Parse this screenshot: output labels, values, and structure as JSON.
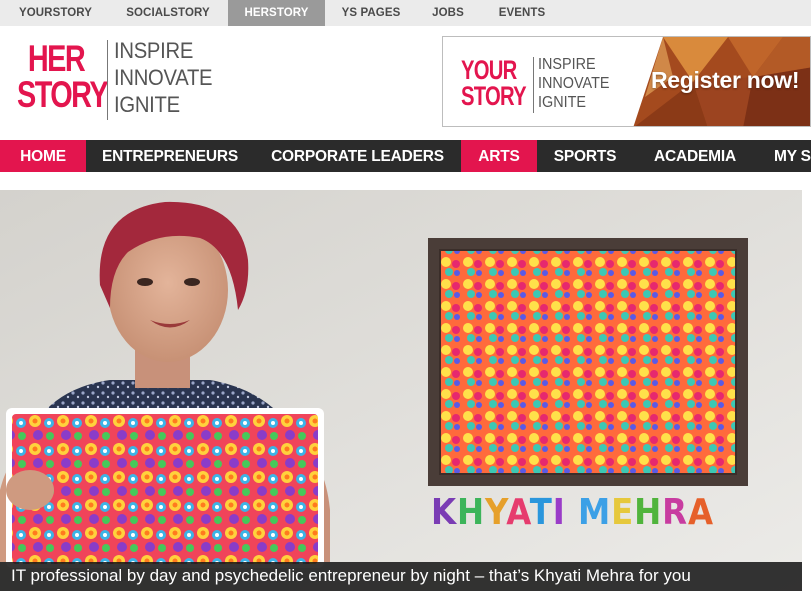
{
  "network_bar": {
    "items": [
      {
        "label": "YOURSTORY",
        "active": false
      },
      {
        "label": "SOCIALSTORY",
        "active": false
      },
      {
        "label": "HERSTORY",
        "active": true
      },
      {
        "label": "YS PAGES",
        "active": false
      },
      {
        "label": "JOBS",
        "active": false
      },
      {
        "label": "EVENTS",
        "active": false
      }
    ]
  },
  "logo": {
    "line1": "HER",
    "line2": "STORY",
    "tagline": [
      "INSPIRE",
      "INNOVATE",
      "IGNITE"
    ]
  },
  "ad_banner": {
    "brand_line1": "YOUR",
    "brand_line2": "STORY",
    "tagline": [
      "INSPIRE",
      "INNOVATE",
      "IGNITE"
    ],
    "cta": "Register now!"
  },
  "main_nav": {
    "items": [
      {
        "label": "HOME",
        "highlight": true
      },
      {
        "label": "ENTREPRENEURS",
        "highlight": false
      },
      {
        "label": "CORPORATE LEADERS",
        "highlight": false
      },
      {
        "label": "ARTS",
        "highlight": true
      },
      {
        "label": "SPORTS",
        "highlight": false
      },
      {
        "label": "ACADEMIA",
        "highlight": false
      },
      {
        "label": "MY S",
        "highlight": false
      }
    ]
  },
  "hero": {
    "name_overlay": "KHYATI MEHRA",
    "caption": "IT professional by day and psychedelic entrepreneur by night – that’s Khyati Mehra for you"
  },
  "colors": {
    "brand_pink": "#e3154e",
    "nav_bg": "#2b2b2b",
    "network_bar_bg": "#ebebeb",
    "network_active_bg": "#9a9a9a"
  }
}
